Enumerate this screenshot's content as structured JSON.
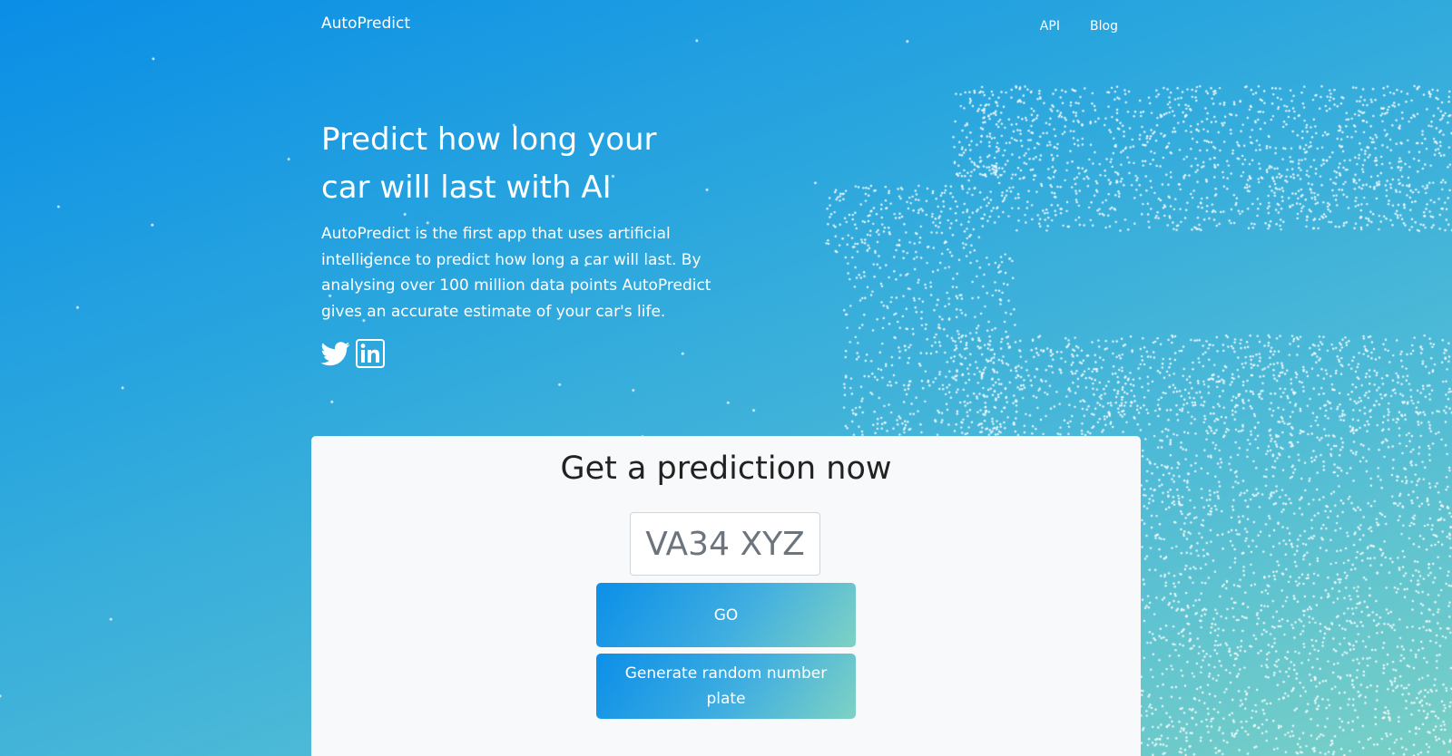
{
  "nav": {
    "brand": "AutoPredict",
    "links": [
      {
        "label": "API"
      },
      {
        "label": "Blog"
      }
    ]
  },
  "hero": {
    "title": "Predict how long your car will last with AI",
    "description": "AutoPredict is the first app that uses artificial intelligence to predict how long a car will last. By analysing over 100 million data points AutoPredict gives an accurate estimate of your car's life."
  },
  "social": {
    "icons": [
      "twitter-icon",
      "linkedin-icon"
    ]
  },
  "prediction": {
    "title": "Get a prediction now",
    "plate_placeholder": "VA34 XYZ",
    "plate_value": "",
    "go_label": "GO",
    "random_label": "Generate random number plate"
  },
  "colors": {
    "gradient_start": "#0a8ee6",
    "gradient_end": "#79d0c6",
    "card_background": "#f8f9fa"
  }
}
